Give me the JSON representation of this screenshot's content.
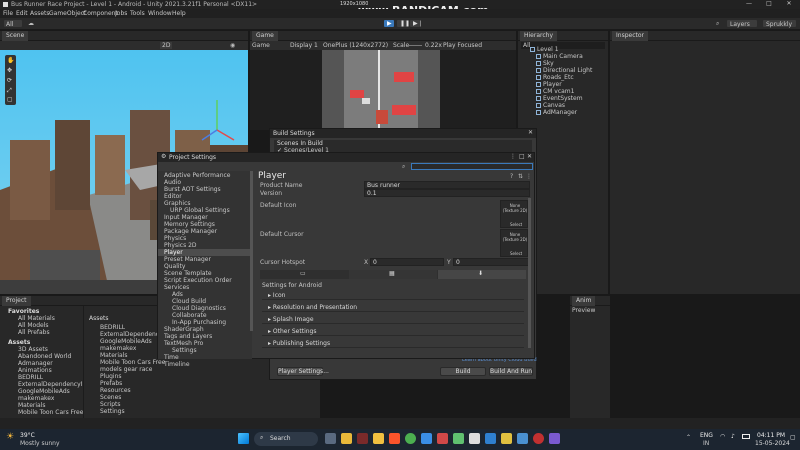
{
  "window": {
    "title": "Bus Runner Race Project - Level 1 - Android - Unity 2021.3.21f1 Personal <DX11>"
  },
  "menu": [
    "File",
    "Edit",
    "Assets",
    "GameObject",
    "Component",
    "Jobs",
    "Tools",
    "Window",
    "Help"
  ],
  "recorder": {
    "resolution": "1920x1080",
    "brand": "www.BANDICAM.com"
  },
  "toolbar": {
    "account": "All",
    "layers": "Layers",
    "layout": "Sprukkly"
  },
  "scene": {
    "tab": "Scene",
    "mode": "2D"
  },
  "game": {
    "tab": "Game",
    "mode": "Game",
    "display": "Display 1",
    "resolution": "OnePlus (1240x2772)",
    "scale_label": "Scale",
    "scale": "0.22x",
    "play_mode": "Play Focused"
  },
  "hierarchy": {
    "tab": "Hierarchy",
    "search": "All",
    "root": "Level 1",
    "items": [
      "Main Camera",
      "Sky",
      "Directional Light",
      "Roads_Etc",
      "Player",
      "CM vcam1",
      "EventSystem",
      "Canvas",
      "AdManager"
    ]
  },
  "inspector": {
    "tab": "Inspector"
  },
  "build_settings": {
    "title": "Build Settings",
    "scenes_header": "Scenes In Build",
    "scene_item": "Scenes/Level 1"
  },
  "project_settings": {
    "title": "Project Settings",
    "sidebar": [
      "Adaptive Performance",
      "Audio",
      "Burst AOT Settings",
      "Editor",
      "Graphics",
      "URP Global Settings",
      "Input Manager",
      "Memory Settings",
      "Package Manager",
      "Physics",
      "Physics 2D",
      "Player",
      "Preset Manager",
      "Quality",
      "Scene Template",
      "Script Execution Order",
      "Services",
      "Ads",
      "Cloud Build",
      "Cloud Diagnostics",
      "Collaborate",
      "In-App Purchasing",
      "ShaderGraph",
      "Tags and Layers",
      "TextMesh Pro",
      "Settings",
      "Time",
      "Timeline"
    ],
    "player": {
      "header": "Player",
      "product_name_label": "Product Name",
      "product_name": "Bus runner",
      "version_label": "Version",
      "version": "0.1",
      "default_icon_label": "Default Icon",
      "none_texture": "None (Texture 2D)",
      "select": "Select",
      "default_cursor_label": "Default Cursor",
      "cursor_hotspot_label": "Cursor Hotspot",
      "hotspot_x_label": "X",
      "hotspot_x": "0",
      "hotspot_y_label": "Y",
      "hotspot_y": "0",
      "android_settings": "Settings for Android",
      "sections": [
        "Icon",
        "Resolution and Presentation",
        "Splash Image",
        "Other Settings",
        "Publishing Settings"
      ]
    }
  },
  "build_buttons": {
    "player_settings": "Player Settings...",
    "build": "Build",
    "build_and_run": "Build And Run",
    "learn_link": "Learn about Unity Cloud Build"
  },
  "project": {
    "tab": "Project",
    "favorites": "Favorites",
    "fav_items": [
      "All Materials",
      "All Models",
      "All Prefabs"
    ],
    "assets_root": "Assets",
    "tree": [
      "3D Assets",
      "Abandoned World",
      "Admanager",
      "Animations",
      "BEDRILL",
      "ExternalDependencyManager",
      "GoogleMobileAds",
      "makemakex",
      "Materials",
      "Mobile Toon Cars Free"
    ],
    "assets_header": "Assets",
    "assets_list": [
      "BEDRILL",
      "ExternalDependencyMa...",
      "GoogleMobileAds",
      "makemakex",
      "Materials",
      "Mobile Toon Cars Free",
      "models gear race",
      "Plugins",
      "Prefabs",
      "Resources",
      "Scenes",
      "Scripts",
      "Settings"
    ]
  },
  "anim": {
    "tab": "Anim",
    "preview": "Preview"
  },
  "taskbar": {
    "weather_temp": "39°C",
    "weather_desc": "Mostly sunny",
    "search": "Search",
    "lang": "ENG",
    "region": "IN",
    "time": "04:11 PM",
    "date": "15-05-2024"
  },
  "colors": {
    "accent": "#2c5d87",
    "play_blue": "#3a79bb",
    "sky": "#4fc3f0"
  }
}
